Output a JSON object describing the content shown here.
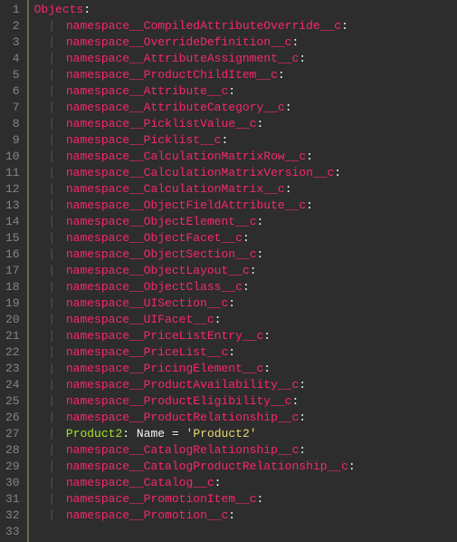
{
  "root_key": "Objects",
  "colon": ":",
  "pipe": "|",
  "lines": [
    {
      "type": "ns",
      "key": "namespace__CompiledAttributeOverride__c"
    },
    {
      "type": "ns",
      "key": "namespace__OverrideDefinition__c"
    },
    {
      "type": "ns",
      "key": "namespace__AttributeAssignment__c"
    },
    {
      "type": "ns",
      "key": "namespace__ProductChildItem__c"
    },
    {
      "type": "ns",
      "key": "namespace__Attribute__c"
    },
    {
      "type": "ns",
      "key": "namespace__AttributeCategory__c"
    },
    {
      "type": "ns",
      "key": "namespace__PicklistValue__c"
    },
    {
      "type": "ns",
      "key": "namespace__Picklist__c"
    },
    {
      "type": "ns",
      "key": "namespace__CalculationMatrixRow__c"
    },
    {
      "type": "ns",
      "key": "namespace__CalculationMatrixVersion__c"
    },
    {
      "type": "ns",
      "key": "namespace__CalculationMatrix__c"
    },
    {
      "type": "ns",
      "key": "namespace__ObjectFieldAttribute__c"
    },
    {
      "type": "ns",
      "key": "namespace__ObjectElement__c"
    },
    {
      "type": "ns",
      "key": "namespace__ObjectFacet__c"
    },
    {
      "type": "ns",
      "key": "namespace__ObjectSection__c"
    },
    {
      "type": "ns",
      "key": "namespace__ObjectLayout__c"
    },
    {
      "type": "ns",
      "key": "namespace__ObjectClass__c"
    },
    {
      "type": "ns",
      "key": "namespace__UISection__c"
    },
    {
      "type": "ns",
      "key": "namespace__UIFacet__c"
    },
    {
      "type": "ns",
      "key": "namespace__PriceListEntry__c"
    },
    {
      "type": "ns",
      "key": "namespace__PriceList__c"
    },
    {
      "type": "ns",
      "key": "namespace__PricingElement__c"
    },
    {
      "type": "ns",
      "key": "namespace__ProductAvailability__c"
    },
    {
      "type": "ns",
      "key": "namespace__ProductEligibility__c"
    },
    {
      "type": "ns",
      "key": "namespace__ProductRelationship__c"
    },
    {
      "type": "kv",
      "key": "Product2",
      "attr": "Name",
      "eq": "=",
      "value": "'Product2'"
    },
    {
      "type": "ns",
      "key": "namespace__CatalogRelationship__c"
    },
    {
      "type": "ns",
      "key": "namespace__CatalogProductRelationship__c"
    },
    {
      "type": "ns",
      "key": "namespace__Catalog__c"
    },
    {
      "type": "ns",
      "key": "namespace__PromotionItem__c"
    },
    {
      "type": "ns",
      "key": "namespace__Promotion__c"
    }
  ],
  "total_gutter_lines": 33
}
